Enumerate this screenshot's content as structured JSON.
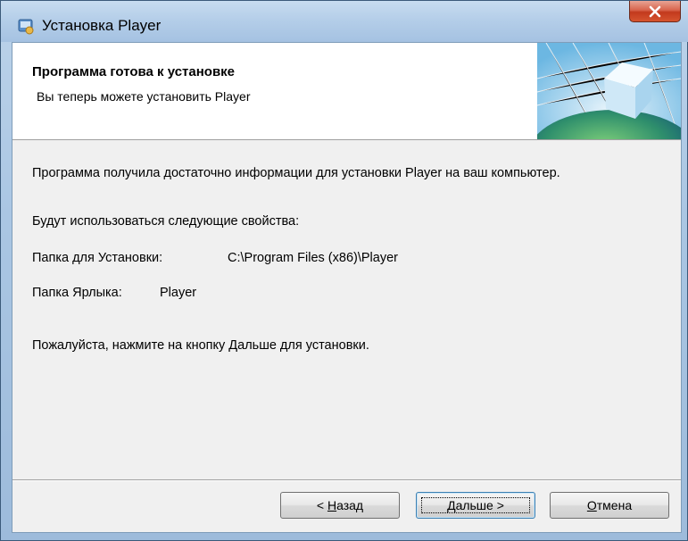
{
  "window": {
    "title": "Установка Player",
    "close_label": "x",
    "icon": "installer-icon"
  },
  "header": {
    "title": "Программа готова к установке",
    "subtitle": "Вы теперь можете установить Player",
    "banner_icon": "globe-cube-banner"
  },
  "body": {
    "intro": "Программа получила достаточно информации для установки Player на ваш компьютер.",
    "properties_heading": "Будут использоваться следующие свойства:",
    "install_folder_label": "Папка для Установки:",
    "install_folder_value": "C:\\Program Files (x86)\\Player",
    "shortcut_folder_label": "Папка Ярлыка:",
    "shortcut_folder_value": "Player",
    "instruction": "Пожалуйста, нажмите на кнопку Дальше для установки."
  },
  "buttons": {
    "back_prefix": "< ",
    "back_mnemonic": "Н",
    "back_rest": "азад",
    "next_mnemonic": "Д",
    "next_rest": "альше >",
    "cancel_mnemonic": "О",
    "cancel_rest": "тмена"
  },
  "colors": {
    "frame": "#aac6e3",
    "close_button": "#c2391d",
    "dialog_background": "#f0f0f0"
  }
}
